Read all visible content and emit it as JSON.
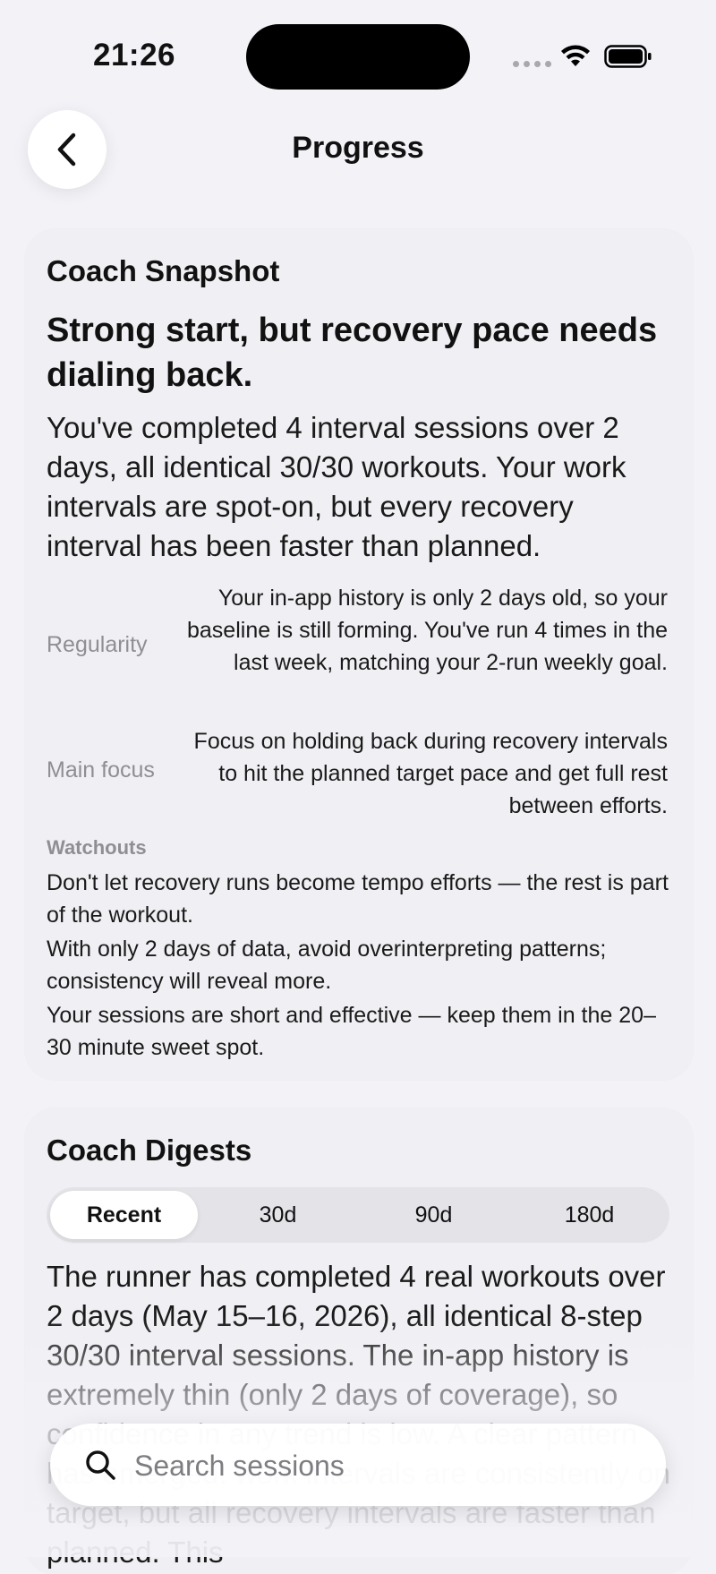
{
  "status_bar": {
    "time": "21:26"
  },
  "nav": {
    "title": "Progress"
  },
  "snapshot": {
    "heading": "Coach Snapshot",
    "headline": "Strong start, but recovery pace needs dialing back.",
    "summary": "You've completed 4 interval sessions over 2 days, all identical 30/30 workouts. Your work intervals are spot-on, but every recovery interval has been faster than planned.",
    "regularity": {
      "label": "Regularity",
      "value": "Your in-app history is only 2 days old, so your baseline is still forming. You've run 4 times in the last week, matching your 2-run weekly goal."
    },
    "main_focus": {
      "label": "Main focus",
      "value": "Focus on holding back during recovery intervals to hit the planned target pace and get full rest between efforts."
    },
    "watchouts_title": "Watchouts",
    "watchouts": [
      "Don't let recovery runs become tempo efforts — the rest is part of the workout.",
      "With only 2 days of data, avoid overinterpreting patterns; consistency will reveal more.",
      "Your sessions are short and effective — keep them in the 20–30 minute sweet spot."
    ]
  },
  "digests": {
    "heading": "Coach Digests",
    "tabs": [
      "Recent",
      "30d",
      "90d",
      "180d"
    ],
    "active_tab": "Recent",
    "text": "The runner has completed 4 real workouts over 2 days (May 15–16, 2026), all identical 8-step 30/30 interval sessions. The in-app history is extremely thin (only 2 days of coverage), so confidence in any trend is low. A clear pattern has emerged: work intervals are consistently on target, but all recovery intervals are faster than planned. This"
  },
  "search": {
    "placeholder": "Search sessions"
  }
}
